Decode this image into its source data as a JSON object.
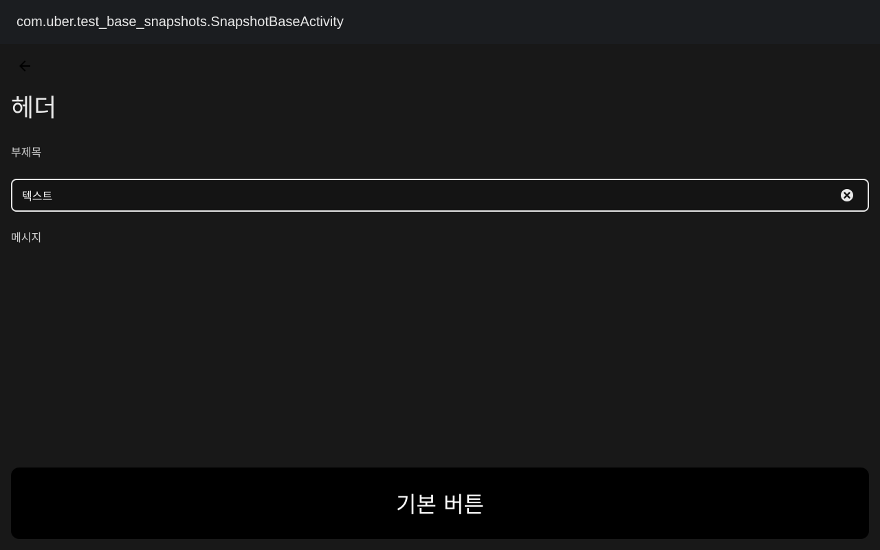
{
  "app_bar": {
    "title": "com.uber.test_base_snapshots.SnapshotBaseActivity"
  },
  "header": {
    "back_icon": "arrow-left-icon",
    "title": "헤더",
    "subtitle": "부제목"
  },
  "text_field": {
    "value": "텍스트",
    "clear_icon": "clear-circle-icon"
  },
  "message": "메시지",
  "primary_button": {
    "label": "기본 버튼"
  },
  "colors": {
    "background": "#181818",
    "app_bar": "#1b1d20",
    "button": "#000000",
    "field_border": "#e4e4e4",
    "caret": "#5aa3e6"
  }
}
